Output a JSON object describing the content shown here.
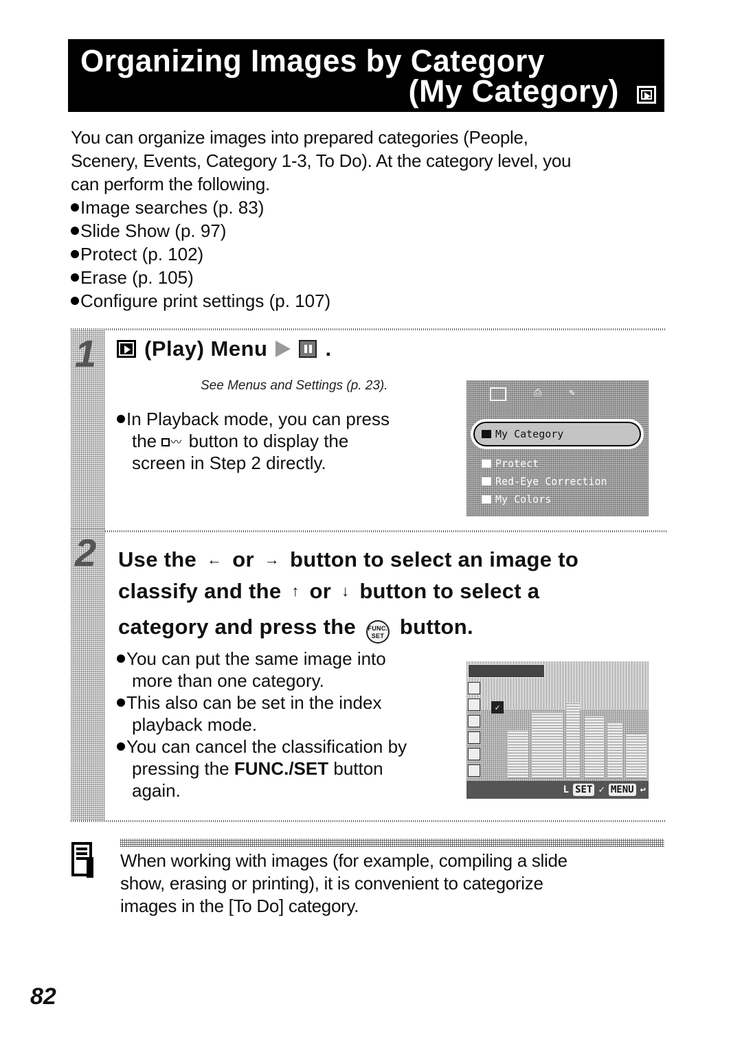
{
  "title": {
    "line1": "Organizing Images by Category",
    "line2": "(My Category)",
    "mode_icon": "play-mode-icon"
  },
  "intro": {
    "paragraph_lines": [
      "You can organize images into prepared categories (People,",
      "Scenery, Events, Category 1-3, To Do). At the category level, you",
      "can perform the following."
    ],
    "bullets": [
      "Image searches (p. 83)",
      "Slide Show (p. 97)",
      "Protect (p. 102)",
      "Erase (p. 105)",
      "Configure print settings (p. 107)"
    ]
  },
  "step1": {
    "number": "1",
    "heading_text": "(Play) Menu",
    "heading_end": ".",
    "icons": [
      "play-mode-icon",
      "menu-arrow-icon",
      "my-category-icon"
    ],
    "see_reference": "See Menus and Settings (p. 23).",
    "bullet_parts": {
      "line1": "In Playback mode, you can press",
      "line2_before": "the",
      "line2_after": "button to display the",
      "line3": "screen in Step 2 directly."
    },
    "shortcut_icon": "print-share-button-icon",
    "lcd_menu": {
      "items": [
        {
          "label": "My Category",
          "icon": "my-category-icon",
          "selected": true
        },
        {
          "label": "Protect",
          "icon": "key-icon",
          "selected": false
        },
        {
          "label": "Red-Eye Correction",
          "icon": "red-eye-icon",
          "selected": false
        },
        {
          "label": "My Colors",
          "icon": "my-colors-icon",
          "selected": false
        }
      ]
    }
  },
  "step2": {
    "number": "2",
    "heading": {
      "part1": "Use the",
      "left_arrow": "←",
      "or1": "or",
      "right_arrow": "→",
      "part2": "button to select an image to",
      "part3": "classify and the",
      "up_arrow": "↑",
      "or2": "or",
      "down_arrow": "↓",
      "part4": "button to select a",
      "part5": "category and press the",
      "func_icon_top": "FUNC.",
      "func_icon_bottom": "SET",
      "part6": "button."
    },
    "bullets": [
      {
        "lines": [
          "You can put the same image into",
          "more than one category."
        ]
      },
      {
        "lines": [
          "This also can be set in the index",
          "playback mode."
        ]
      },
      {
        "line1": "You can cancel the classification by",
        "line2_before": "pressing the",
        "line2_bold": "FUNC./SET",
        "line2_after": "button",
        "line3": "again."
      }
    ],
    "lcd_screen": {
      "bottom_bar": {
        "size": "L",
        "set_label": "SET",
        "check": "✓",
        "menu_label": "MENU",
        "back": "↩"
      }
    }
  },
  "note": {
    "icon": "memo-note-icon",
    "lines": [
      "When working with images (for example, compiling a slide",
      "show, erasing or printing), it is convenient to categorize",
      "images in the [To Do] category."
    ]
  },
  "page_number": "82"
}
